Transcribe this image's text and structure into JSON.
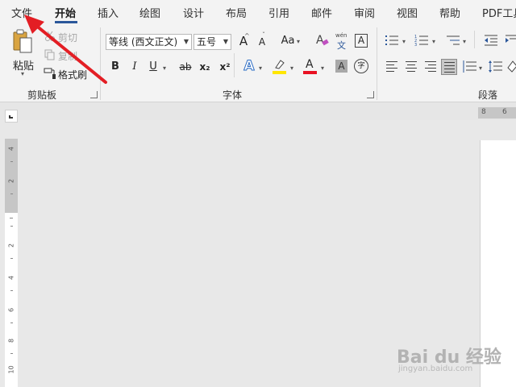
{
  "tabs": [
    "文件",
    "开始",
    "插入",
    "绘图",
    "设计",
    "布局",
    "引用",
    "邮件",
    "审阅",
    "视图",
    "帮助",
    "PDF工具"
  ],
  "clipboard": {
    "paste_label": "粘贴",
    "cut_label": "剪切",
    "copy_label": "复制",
    "format_painter_label": "格式刷",
    "group_label": "剪贴板"
  },
  "font": {
    "font_name": "等线 (西文正文)",
    "font_size": "五号",
    "grow_label": "A",
    "shrink_label": "A",
    "case_label": "Aa",
    "phonetic_top": "wén",
    "phonetic_bottom": "文",
    "border_char": "A",
    "bold": "B",
    "italic": "I",
    "underline": "U",
    "strike": "ab",
    "subscript": "x₂",
    "superscript": "x²",
    "text_effect": "A",
    "font_color_letter": "A",
    "shading_letter": "A",
    "enclose_letter": "字",
    "group_label": "字体",
    "highlight_color": "#ffe600",
    "font_color": "#e81123"
  },
  "paragraph": {
    "group_label": "段落"
  },
  "ruler": {
    "h_numbers": [
      "8",
      "6"
    ],
    "v_numbers": [
      "4",
      "2",
      "2",
      "4",
      "6",
      "8",
      "10"
    ]
  },
  "watermark": {
    "main": "Bai du 经验",
    "sub": "jingyan.baidu.com"
  },
  "colors": {
    "accent": "#2b579a",
    "arrow": "#e31e24"
  }
}
